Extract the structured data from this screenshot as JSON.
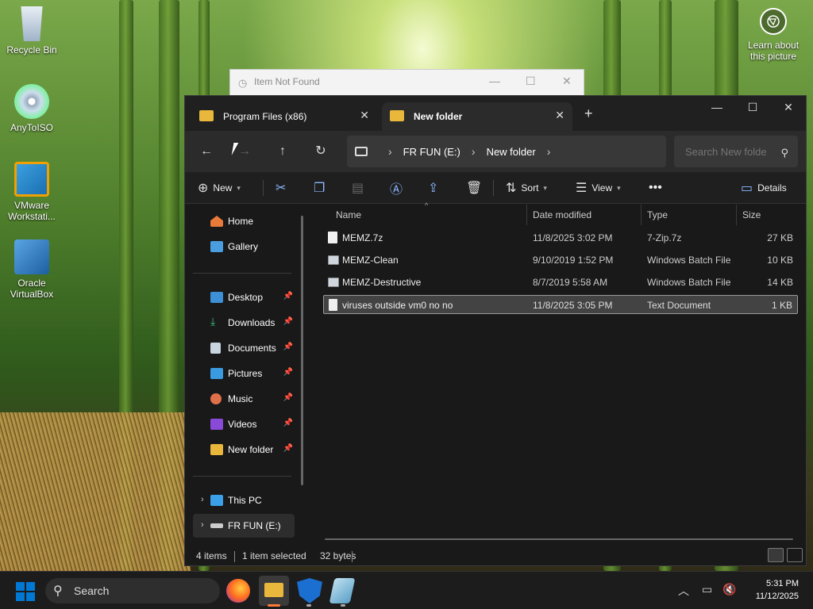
{
  "desktop": {
    "icons": [
      {
        "label": "Recycle Bin"
      },
      {
        "label": "AnyToISO"
      },
      {
        "label": "VMware Workstati..."
      },
      {
        "label": "Oracle VirtualBox"
      }
    ],
    "learn_label": "Learn about this picture"
  },
  "background_window": {
    "title": "Item Not Found"
  },
  "explorer": {
    "tabs": [
      {
        "label": "Program Files (x86)"
      },
      {
        "label": "New folder"
      }
    ],
    "address": {
      "drive": "FR FUN (E:)",
      "folder": "New folder"
    },
    "search_placeholder": "Search New folde",
    "commands": {
      "new": "New",
      "sort": "Sort",
      "view": "View",
      "details": "Details"
    },
    "sidebar": {
      "home": "Home",
      "gallery": "Gallery",
      "quick_access": [
        "Desktop",
        "Downloads",
        "Documents",
        "Pictures",
        "Music",
        "Videos",
        "New folder"
      ],
      "this_pc": "This PC",
      "drive": "FR FUN (E:)"
    },
    "columns": {
      "name": "Name",
      "date": "Date modified",
      "type": "Type",
      "size": "Size"
    },
    "files": [
      {
        "name": "MEMZ.7z",
        "date": "11/8/2025 3:02 PM",
        "type": "7-Zip.7z",
        "size": "27 KB",
        "selected": false
      },
      {
        "name": "MEMZ-Clean",
        "date": "9/10/2019 1:52 PM",
        "type": "Windows Batch File",
        "size": "10 KB",
        "selected": false
      },
      {
        "name": "MEMZ-Destructive",
        "date": "8/7/2019 5:58 AM",
        "type": "Windows Batch File",
        "size": "14 KB",
        "selected": false
      },
      {
        "name": "viruses outside vm0 no no",
        "date": "11/8/2025 3:05 PM",
        "type": "Text Document",
        "size": "1 KB",
        "selected": true
      }
    ],
    "status": {
      "count": "4 items",
      "selected": "1 item selected",
      "bytes": "32 bytes"
    }
  },
  "taskbar": {
    "search_label": "Search",
    "time": "5:31 PM",
    "date": "11/12/2025"
  },
  "colors": {
    "accent": "#0078d4",
    "folder": "#e9b73c",
    "selection": "#434343"
  }
}
